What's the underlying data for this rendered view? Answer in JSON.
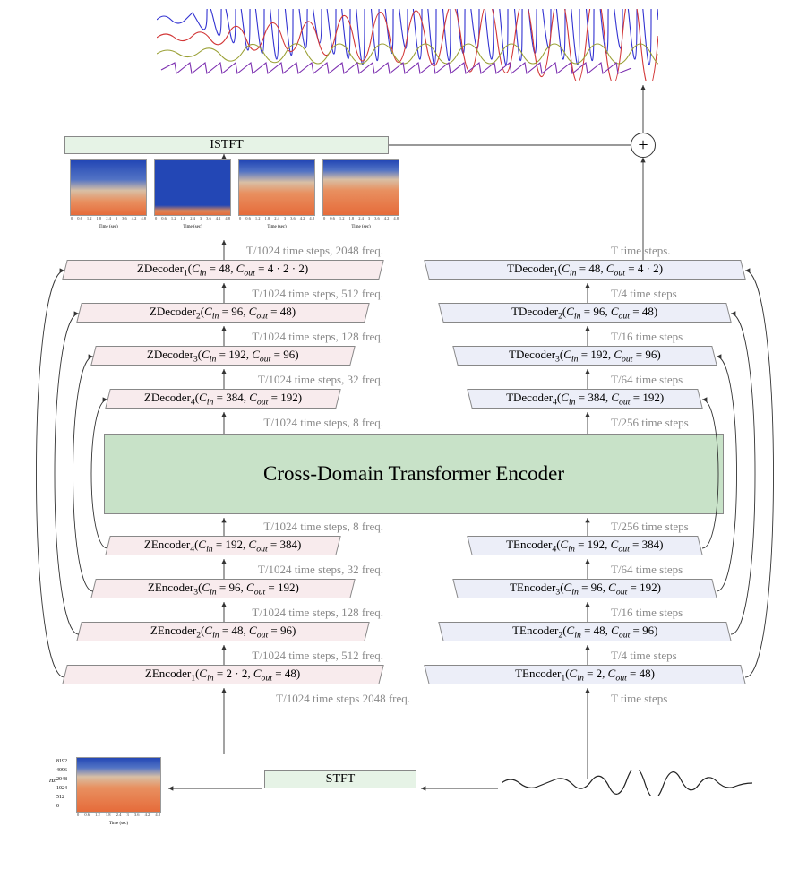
{
  "istft_label": "ISTFT",
  "stft_label": "STFT",
  "transformer_label": "Cross-Domain Transformer Encoder",
  "sum_symbol": "+",
  "z_decoders": [
    {
      "name": "ZDecoder",
      "sub": "1",
      "cin": "48",
      "cout": "4 · 2 · 2",
      "step": "T/1024 time steps, 2048 freq."
    },
    {
      "name": "ZDecoder",
      "sub": "2",
      "cin": "96",
      "cout": "48",
      "step": "T/1024 time steps, 512 freq."
    },
    {
      "name": "ZDecoder",
      "sub": "3",
      "cin": "192",
      "cout": "96",
      "step": "T/1024 time steps, 128 freq."
    },
    {
      "name": "ZDecoder",
      "sub": "4",
      "cin": "384",
      "cout": "192",
      "step": "T/1024 time steps, 32 freq."
    }
  ],
  "t_decoders": [
    {
      "name": "TDecoder",
      "sub": "1",
      "cin": "48",
      "cout": "4 · 2",
      "step": "T time steps."
    },
    {
      "name": "TDecoder",
      "sub": "2",
      "cin": "96",
      "cout": "48",
      "step": "T/4 time steps"
    },
    {
      "name": "TDecoder",
      "sub": "3",
      "cin": "192",
      "cout": "96",
      "step": "T/16 time steps"
    },
    {
      "name": "TDecoder",
      "sub": "4",
      "cin": "384",
      "cout": "192",
      "step": "T/64 time steps"
    }
  ],
  "z_mid_step": "T/1024 time steps, 8 freq.",
  "t_mid_step": "T/256 time steps",
  "z_encoders": [
    {
      "name": "ZEncoder",
      "sub": "4",
      "cin": "192",
      "cout": "384",
      "step": "T/1024 time steps, 8 freq."
    },
    {
      "name": "ZEncoder",
      "sub": "3",
      "cin": "96",
      "cout": "192",
      "step": "T/1024 time steps, 32 freq."
    },
    {
      "name": "ZEncoder",
      "sub": "2",
      "cin": "48",
      "cout": "96",
      "step": "T/1024 time steps, 128 freq."
    },
    {
      "name": "ZEncoder",
      "sub": "1",
      "cin": "2 · 2",
      "cout": "48",
      "step": "T/1024 time steps, 512 freq."
    }
  ],
  "t_encoders": [
    {
      "name": "TEncoder",
      "sub": "4",
      "cin": "192",
      "cout": "384",
      "step": "T/256 time steps"
    },
    {
      "name": "TEncoder",
      "sub": "3",
      "cin": "96",
      "cout": "192",
      "step": "T/64 time steps"
    },
    {
      "name": "TEncoder",
      "sub": "2",
      "cin": "48",
      "cout": "96",
      "step": "T/16 time steps"
    },
    {
      "name": "TEncoder",
      "sub": "1",
      "cin": "2",
      "cout": "48",
      "step": "T/4 time steps"
    }
  ],
  "z_in_step": "T/1024 time steps 2048 freq.",
  "t_in_step": "T time steps",
  "spec_ticks": [
    "0",
    "0.6",
    "1.2",
    "1.8",
    "2.4",
    "3",
    "3.6",
    "4.2",
    "4.8"
  ],
  "spec_xlabel": "Time (sec)",
  "spec_yticks": [
    "8192",
    "4096",
    "2048",
    "1024",
    "512",
    "0"
  ],
  "spec_ylabel": "Hz",
  "colors": {
    "z_block": "#f8ebed",
    "t_block": "#eceef8",
    "stft_block": "#e6f3e6",
    "transformer": "#c8e2c8",
    "wave1": "#3232d1",
    "wave2": "#d23636",
    "wave3": "#9aa035",
    "wave4": "#7c2fb0"
  }
}
